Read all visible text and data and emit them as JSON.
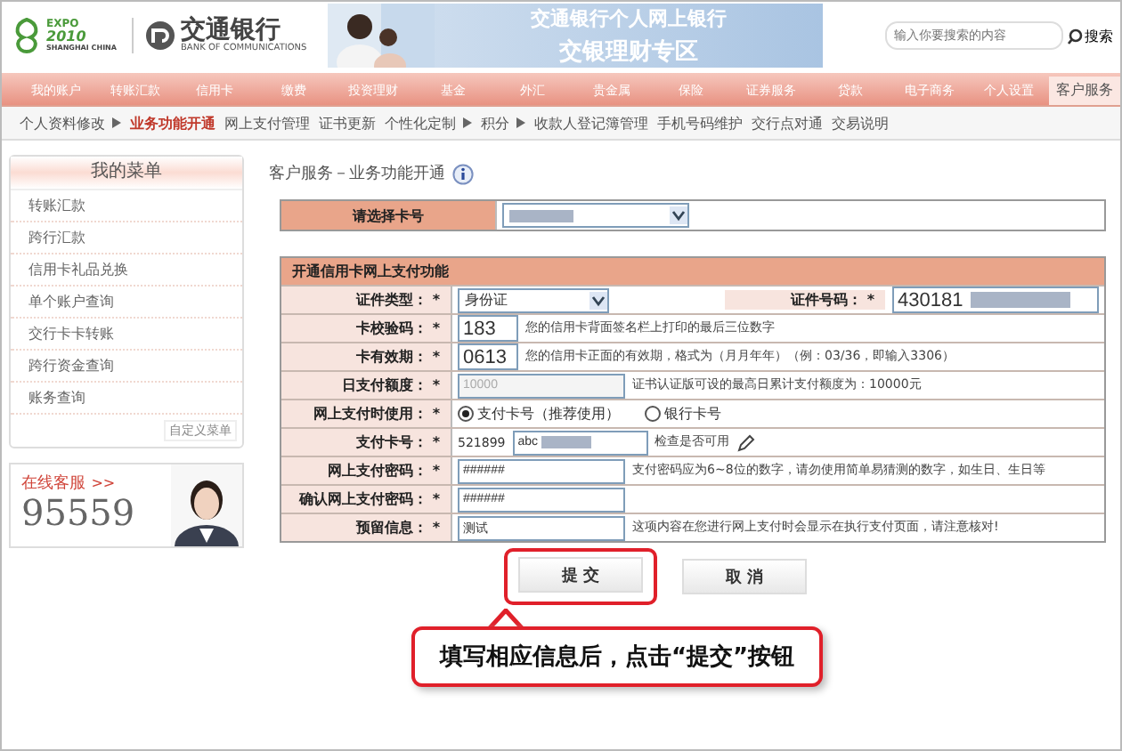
{
  "header": {
    "expo_logo": {
      "title": "EXPO",
      "year": "2010",
      "city": "SHANGHAI CHINA"
    },
    "bank_name": "交通银行",
    "bank_name_en": "BANK OF COMMUNICATIONS",
    "banner": {
      "title": "交通银行个人网上银行",
      "subtitle": "交银理财专区"
    },
    "search": {
      "placeholder": "输入你要搜索的内容",
      "button": "搜索"
    }
  },
  "nav": [
    {
      "label": "我的账户",
      "selected": false
    },
    {
      "label": "转账汇款",
      "selected": false
    },
    {
      "label": "信用卡",
      "selected": false
    },
    {
      "label": "缴费",
      "selected": false
    },
    {
      "label": "投资理财",
      "selected": false
    },
    {
      "label": "基金",
      "selected": false
    },
    {
      "label": "外汇",
      "selected": false
    },
    {
      "label": "贵金属",
      "selected": false
    },
    {
      "label": "保险",
      "selected": false
    },
    {
      "label": "证券服务",
      "selected": false
    },
    {
      "label": "贷款",
      "selected": false
    },
    {
      "label": "电子商务",
      "selected": false
    },
    {
      "label": "个人设置",
      "selected": false
    },
    {
      "label": "客户服务",
      "selected": true
    }
  ],
  "subnav": [
    {
      "label": "个人资料修改",
      "dropdown": true,
      "selected": false
    },
    {
      "label": "业务功能开通",
      "dropdown": false,
      "selected": true
    },
    {
      "label": "网上支付管理",
      "dropdown": false,
      "selected": false
    },
    {
      "label": "证书更新",
      "dropdown": false,
      "selected": false
    },
    {
      "label": "个性化定制",
      "dropdown": true,
      "selected": false
    },
    {
      "label": "积分",
      "dropdown": true,
      "selected": false
    },
    {
      "label": "收款人登记簿管理",
      "dropdown": false,
      "selected": false
    },
    {
      "label": "手机号码维护",
      "dropdown": false,
      "selected": false
    },
    {
      "label": "交行点对通",
      "dropdown": false,
      "selected": false
    },
    {
      "label": "交易说明",
      "dropdown": false,
      "selected": false
    }
  ],
  "sidebar": {
    "title": "我的菜单",
    "items": [
      "转账汇款",
      "跨行汇款",
      "信用卡礼品兑换",
      "单个账户查询",
      "交行卡卡转账",
      "跨行资金查询",
      "账务查询"
    ],
    "custom_link": "自定义菜单",
    "service": {
      "label": "在线客服",
      "arrow": ">>",
      "phone": "95559"
    }
  },
  "page_title": "客户服务－业务功能开通",
  "card_select": {
    "label": "请选择卡号"
  },
  "form": {
    "title": "开通信用卡网上支付功能",
    "rows": [
      {
        "kind": "pair",
        "label": "证件类型： *",
        "value": "身份证",
        "label2": "证件号码： *",
        "value2": "430181"
      },
      {
        "kind": "code",
        "label": "卡校验码： *",
        "value": "183",
        "disabled": false,
        "note": "您的信用卡背面签名栏上打印的最后三位数字"
      },
      {
        "kind": "code",
        "label": "卡有效期： *",
        "value": "0613",
        "disabled": false,
        "note": "您的信用卡正面的有效期，格式为（月月年年）（例：03/36，即输入3306）"
      },
      {
        "kind": "input",
        "label": "日支付额度： *",
        "value": "10000",
        "disabled": true,
        "note": "证书认证版可设的最高日累计支付额度为：10000元"
      },
      {
        "kind": "radio",
        "label": "网上支付时使用： *",
        "options": [
          {
            "label": "支付卡号（推荐使用）",
            "selected": true
          },
          {
            "label": "银行卡号",
            "selected": false
          }
        ]
      },
      {
        "kind": "card",
        "label": "支付卡号： *",
        "prefix": "521899",
        "value": "abc",
        "link": "检查是否可用"
      },
      {
        "kind": "input",
        "label": "网上支付密码： *",
        "value": "######",
        "disabled": false,
        "note": "支付密码应为6~8位的数字，请勿使用简单易猜测的数字，如生日、生日等"
      },
      {
        "kind": "input",
        "label": "确认网上支付密码： *",
        "value": "######",
        "disabled": false
      },
      {
        "kind": "input",
        "label": "预留信息： *",
        "value": "测试",
        "disabled": false,
        "note": "这项内容在您进行网上支付时会显示在执行支付页面，请注意核对!"
      }
    ]
  },
  "buttons": [
    {
      "label": "提 交",
      "highlighted": true
    },
    {
      "label": "取 消",
      "highlighted": false
    }
  ],
  "callout": "填写相应信息后，点击“提交”按钮"
}
